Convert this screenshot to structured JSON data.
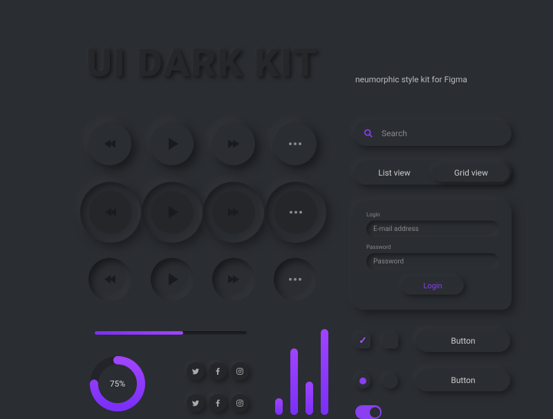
{
  "header": {
    "title": "UI DARK KIT",
    "subtitle": "neumorphic style kit for Figma"
  },
  "search": {
    "placeholder": "Search"
  },
  "view_toggle": {
    "list": "List view",
    "grid": "Grid view"
  },
  "login": {
    "login_label": "Login",
    "password_label": "Password",
    "email_placeholder": "E-mail address",
    "password_placeholder": "Password",
    "submit": "Login"
  },
  "buttons": {
    "primary": "Button",
    "secondary": "Button"
  },
  "progress": {
    "donut_percent": "75%"
  },
  "colors": {
    "accent": "#8a3ff0",
    "bg": "#2a2d32"
  },
  "chart_data": {
    "type": "bar",
    "values": [
      30,
      120,
      60,
      155
    ],
    "empty_slots": 2,
    "title": "",
    "xlabel": "",
    "ylabel": ""
  }
}
